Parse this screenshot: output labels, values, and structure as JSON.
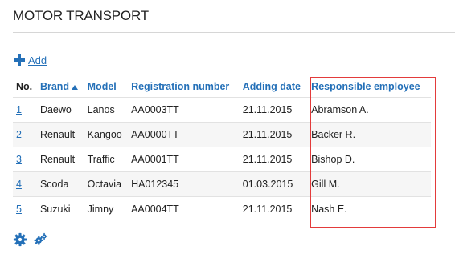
{
  "page": {
    "title": "MOTOR TRANSPORT"
  },
  "toolbar": {
    "add_label": "Add"
  },
  "table": {
    "columns": [
      "No.",
      "Brand",
      "Model",
      "Registration number",
      "Adding date",
      "Responsible employee"
    ],
    "sorted_column": "Brand",
    "rows": [
      {
        "no": "1",
        "brand": "Daewo",
        "model": "Lanos",
        "reg": "AA0003TT",
        "date": "21.11.2015",
        "employee": "Abramson A."
      },
      {
        "no": "2",
        "brand": "Renault",
        "model": "Kangoo",
        "reg": "AA0000TT",
        "date": "21.11.2015",
        "employee": "Backer R."
      },
      {
        "no": "3",
        "brand": "Renault",
        "model": "Traffic",
        "reg": "AA0001TT",
        "date": "21.11.2015",
        "employee": "Bishop D."
      },
      {
        "no": "4",
        "brand": "Scoda",
        "model": "Octavia",
        "reg": "HA012345",
        "date": "01.03.2015",
        "employee": "Gill M."
      },
      {
        "no": "5",
        "brand": "Suzuki",
        "model": "Jimny",
        "reg": "AA0004TT",
        "date": "21.11.2015",
        "employee": "Nash E."
      }
    ]
  },
  "icons": {
    "add": "plus-icon",
    "settings": "gear-icon",
    "multi_settings": "gears-icon"
  },
  "colors": {
    "link": "#2470b8",
    "highlight": "#e33b3b"
  }
}
